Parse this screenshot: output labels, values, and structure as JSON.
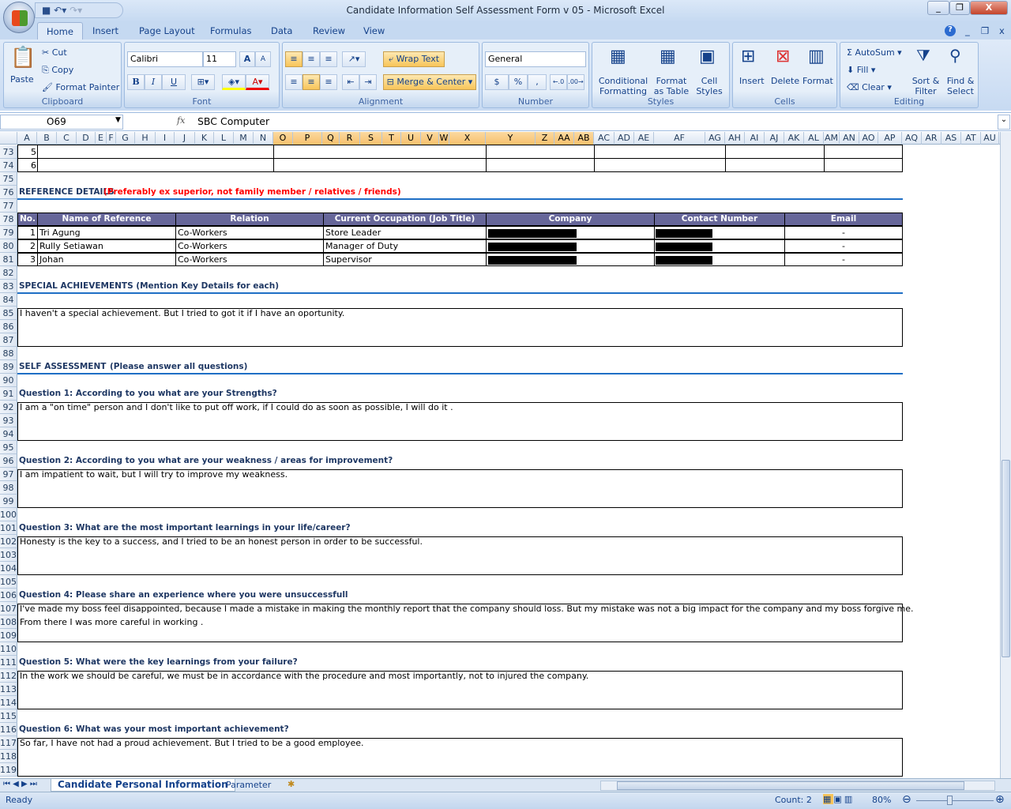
{
  "window": {
    "title": "Candidate Information Self Assessment Form v 05  -  Microsoft Excel"
  },
  "ribbon": {
    "tabs": [
      "Home",
      "Insert",
      "Page Layout",
      "Formulas",
      "Data",
      "Review",
      "View"
    ],
    "clipboard": {
      "paste": "Paste",
      "cut": "Cut",
      "copy": "Copy",
      "format_painter": "Format Painter",
      "label": "Clipboard"
    },
    "font": {
      "name": "Calibri",
      "size": "11",
      "bold": "B",
      "italic": "I",
      "underline": "U",
      "label": "Font"
    },
    "alignment": {
      "wrap": "Wrap Text",
      "merge": "Merge & Center",
      "label": "Alignment"
    },
    "number": {
      "format": "General",
      "currency": "$",
      "percent": "%",
      "comma": ",",
      "label": "Number"
    },
    "styles": {
      "conditional": "Conditional Formatting",
      "format_table": "Format as Table",
      "cell_styles": "Cell Styles",
      "label": "Styles"
    },
    "cells": {
      "insert": "Insert",
      "delete": "Delete",
      "format": "Format",
      "label": "Cells"
    },
    "editing": {
      "autosum": "AutoSum",
      "fill": "Fill",
      "clear": "Clear",
      "sort": "Sort & Filter",
      "find": "Find & Select",
      "label": "Editing"
    }
  },
  "formula_bar": {
    "name_box": "O69",
    "fx": "fx",
    "value": "SBC Computer"
  },
  "columns": [
    "A",
    "B",
    "C",
    "D",
    "E",
    "F",
    "G",
    "H",
    "I",
    "J",
    "K",
    "L",
    "M",
    "N",
    "O",
    "P",
    "Q",
    "R",
    "S",
    "T",
    "U",
    "V",
    "W",
    "X",
    "Y",
    "Z",
    "AA",
    "AB",
    "AC",
    "AD",
    "AE",
    "AF",
    "AG",
    "AH",
    "AI",
    "AJ",
    "AK",
    "AL",
    "AM",
    "AN",
    "AO",
    "AP",
    "AQ",
    "AR",
    "AS",
    "AT",
    "AU"
  ],
  "selected_columns": [
    "O",
    "P",
    "Q",
    "R",
    "S",
    "T",
    "U",
    "V",
    "W",
    "X",
    "Y",
    "Z",
    "AA",
    "AB"
  ],
  "sheet": {
    "first_row": 73,
    "last_row": 119,
    "prev_rows": [
      {
        "row": 73,
        "no": "5"
      },
      {
        "row": 74,
        "no": "6"
      }
    ],
    "reference_title": "REFERENCE DETAILS",
    "reference_note": "(Preferably ex superior, not family member / relatives / friends)",
    "reference_headers": [
      "No.",
      "Name of Reference",
      "Relation",
      "Current Occupation (Job Title)",
      "Company",
      "Contact Number",
      "Email"
    ],
    "references": [
      {
        "no": "1",
        "name": "Tri Agung",
        "relation": "Co-Workers",
        "occupation": "Store Leader",
        "email": "-"
      },
      {
        "no": "2",
        "name": "Rully Setiawan",
        "relation": "Co-Workers",
        "occupation": "Manager of Duty",
        "email": "-"
      },
      {
        "no": "3",
        "name": "Johan",
        "relation": "Co-Workers",
        "occupation": "Supervisor",
        "email": "-"
      }
    ],
    "special_title": "SPECIAL ACHIEVEMENTS (Mention Key Details for each)",
    "special_answer": "I haven't  a special achievement. But I tried to got it if I have an oportunity.",
    "self_title": "SELF ASSESSMENT",
    "self_note": "(Please answer all questions)",
    "questions": [
      {
        "row": 91,
        "q": "Question 1: According to you what are your Strengths?",
        "a": [
          "I am a \"on time\" person and I don't like to put off work, if I could do as soon as possible,  I will do it ."
        ]
      },
      {
        "row": 96,
        "q": "Question 2: According to you what are your weakness / areas for improvement?",
        "a": [
          "I am impatient to wait, but I will try to improve my weakness."
        ]
      },
      {
        "row": 101,
        "q": "Question 3: What are the most important learnings in your life/career?",
        "a": [
          "Honesty is the key to a success, and I tried to be an honest person in order to be successful."
        ]
      },
      {
        "row": 106,
        "q": "Question 4: Please share an experience where you were unsuccessfull",
        "a": [
          "I've made my boss feel disappointed, because I made a mistake in making the monthly report that the company should loss. But my mistake was not a big impact for the company and my boss forgive me.",
          "From there I was more careful in working ."
        ]
      },
      {
        "row": 111,
        "q": "Question 5: What were the key learnings from your failure?",
        "a": [
          "In the work we should be careful, we must be in accordance with the procedure and most importantly, not to injured the company."
        ]
      },
      {
        "row": 116,
        "q": "Question 6: What was your most important achievement?",
        "a": [
          "So far, I have not had a proud achievement. But I tried to be a good employee."
        ]
      }
    ]
  },
  "sheet_tabs": [
    "Candidate Personal Information",
    "Parameter"
  ],
  "status": {
    "ready": "Ready",
    "count": "Count: 2",
    "zoom": "80%",
    "zoom_percent": 80
  },
  "colors": {
    "header_fill": "#666699",
    "section_text": "#1f3864",
    "note_red": "#ff0000",
    "selection": "#f7c06c"
  }
}
